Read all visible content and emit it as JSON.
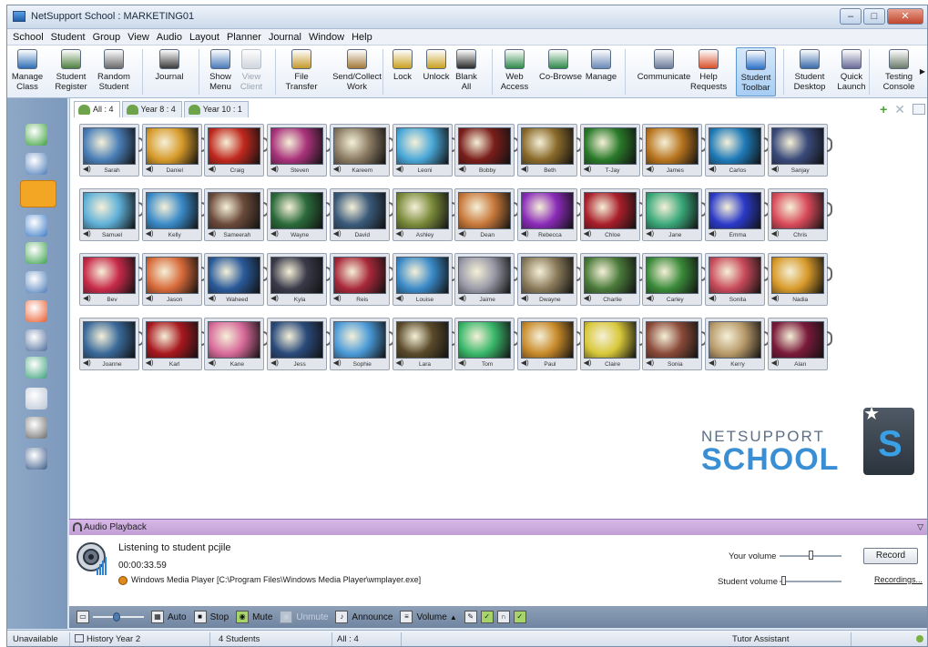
{
  "window": {
    "title": "NetSupport School : MARKETING01"
  },
  "menu": [
    "School",
    "Student",
    "Group",
    "View",
    "Audio",
    "Layout",
    "Planner",
    "Journal",
    "Window",
    "Help"
  ],
  "toolbar": [
    {
      "label": "Manage\nClass",
      "icon": "manage-class-icon"
    },
    {
      "label": "Student\nRegister",
      "icon": "student-register-icon"
    },
    {
      "label": "Random\nStudent",
      "icon": "random-student-icon"
    },
    {
      "label": "Journal",
      "icon": "journal-icon"
    },
    {
      "label": "Show\nMenu",
      "icon": "show-icon"
    },
    {
      "label": "View\nClient",
      "icon": "view-client-icon",
      "disabled": true
    },
    {
      "label": "File\nTransfer",
      "icon": "file-transfer-icon"
    },
    {
      "label": "Send/Collect\nWork",
      "icon": "send-collect-icon"
    },
    {
      "label": "Lock",
      "icon": "lock-icon"
    },
    {
      "label": "Unlock",
      "icon": "unlock-icon"
    },
    {
      "label": "Blank\nAll",
      "icon": "blank-all-icon"
    },
    {
      "label": "Web\nAccess",
      "icon": "web-access-icon"
    },
    {
      "label": "Co-Browse",
      "icon": "co-browse-icon"
    },
    {
      "label": "Manage",
      "icon": "manage-icon"
    },
    {
      "label": "Communicate",
      "icon": "communicate-icon"
    },
    {
      "label": "Help\nRequests",
      "icon": "help-requests-icon"
    },
    {
      "label": "Student\nToolbar",
      "icon": "student-toolbar-icon",
      "active": true
    },
    {
      "label": "Student\nDesktop",
      "icon": "student-desktop-icon"
    },
    {
      "label": "Quick\nLaunch",
      "icon": "quick-launch-icon"
    },
    {
      "label": "Testing\nConsole",
      "icon": "testing-console-icon"
    }
  ],
  "tabs": [
    {
      "label": "All : 4"
    },
    {
      "label": "Year 8 : 4"
    },
    {
      "label": "Year 10 : 1"
    }
  ],
  "students": [
    [
      "Sarah",
      "Daniel",
      "Craig",
      "Steven",
      "Kareem",
      "Leoni",
      "Bobby",
      "Beth",
      "T-Jay",
      "James",
      "Carlos",
      "Sanjay"
    ],
    [
      "Samuel",
      "Kelly",
      "Sameerah",
      "Wayne",
      "David",
      "Ashley",
      "Dean",
      "Rebecca",
      "Chloe",
      "Jane",
      "Emma",
      "Chris"
    ],
    [
      "Bev",
      "Jason",
      "Waheed",
      "Kyla",
      "Reis",
      "Louise",
      "Jaime",
      "Dwayne",
      "Charlie",
      "Carley",
      "Sonita",
      "Nadia"
    ],
    [
      "Joanne",
      "Karl",
      "Kane",
      "Jess",
      "Sophie",
      "Lara",
      "Tom",
      "Paul",
      "Claire",
      "Sonia",
      "Kerry",
      "Alan"
    ]
  ],
  "thumb_colors": [
    [
      "#4a7fb8",
      "#d79a2a",
      "#c0281e",
      "#a8327a",
      "#8a7a62",
      "#4aa8d8",
      "#7a1e1a",
      "#8a6a2a",
      "#2a7a2a",
      "#b8741e",
      "#1e7ab8",
      "#3a4a7a"
    ],
    [
      "#5fb0d8",
      "#3a8ac8",
      "#6a4a3a",
      "#2a6a3a",
      "#3a5a7a",
      "#7a8a3a",
      "#c8783a",
      "#8a2ab8",
      "#a81e2a",
      "#3aa87a",
      "#2a3ac8",
      "#d84a5a"
    ],
    [
      "#c82a4a",
      "#d86a3a",
      "#2a5a9a",
      "#3a3a4a",
      "#a8283a",
      "#3a8ac8",
      "#9a9aa8",
      "#8a7a5a",
      "#4a7a3a",
      "#3a8a3a",
      "#c84a5a",
      "#d89a2a"
    ],
    [
      "#3a6a9a",
      "#a8181e",
      "#d86a9a",
      "#2a4a7a",
      "#4a9ad8",
      "#5a4a2a",
      "#3ab86a",
      "#c88a2a",
      "#d8c83a",
      "#8a4a3a",
      "#b89a6a",
      "#7a1a3a"
    ]
  ],
  "brand": {
    "net": "NETSUPPORT",
    "school": "SCHOOL",
    "s": "S"
  },
  "audio": {
    "header": "Audio Playback",
    "listening": "Listening to student pcjile",
    "duration": "00:00:33.59",
    "player": "Windows Media Player [C:\\Program Files\\Windows Media Player\\wmplayer.exe]",
    "your_volume": "Your volume",
    "student_volume": "Student volume",
    "record": "Record",
    "recordings": "Recordings..."
  },
  "audio_bar": {
    "auto": "Auto",
    "stop": "Stop",
    "mute": "Mute",
    "unmute": "Unmute",
    "announce": "Announce",
    "volume": "Volume"
  },
  "status": {
    "state": "Unavailable",
    "history": "History Year 2",
    "students": "4 Students",
    "all": "All : 4",
    "tutor": "Tutor Assistant"
  }
}
